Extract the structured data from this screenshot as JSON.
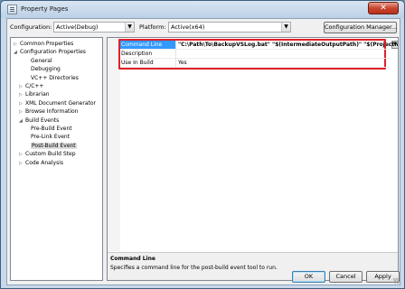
{
  "window": {
    "title": "Property Pages",
    "close_glyph": "✕"
  },
  "toolbar": {
    "configuration_label": "Configuration:",
    "configuration_value": "Active(Debug)",
    "platform_label": "Platform:",
    "platform_value": "Active(x64)",
    "config_manager_label": "Configuration Manager..."
  },
  "tree": [
    {
      "label": "Common Properties",
      "expander": "▷",
      "selected": false
    },
    {
      "label": "Configuration Properties",
      "expander": "◢",
      "selected": false
    },
    {
      "label": "General",
      "expander": "",
      "selected": false
    },
    {
      "label": "Debugging",
      "expander": "",
      "selected": false
    },
    {
      "label": "VC++ Directories",
      "expander": "",
      "selected": false
    },
    {
      "label": "C/C++",
      "expander": "▷",
      "selected": false
    },
    {
      "label": "Librarian",
      "expander": "▷",
      "selected": false
    },
    {
      "label": "XML Document Generator",
      "expander": "▷",
      "selected": false
    },
    {
      "label": "Browse Information",
      "expander": "▷",
      "selected": false
    },
    {
      "label": "Build Events",
      "expander": "◢",
      "selected": false
    },
    {
      "label": "Pre-Build Event",
      "expander": "",
      "selected": false
    },
    {
      "label": "Pre-Link Event",
      "expander": "",
      "selected": false
    },
    {
      "label": "Post-Build Event",
      "expander": "",
      "selected": true
    },
    {
      "label": "Custom Build Step",
      "expander": "▷",
      "selected": false
    },
    {
      "label": "Code Analysis",
      "expander": "▷",
      "selected": false
    }
  ],
  "properties": [
    {
      "name": "Command Line",
      "value": "\"C:\\Path\\To\\BackupVSLog.bat\" \"$(IntermediateOutputPath)\" \"$(ProjectName)\"",
      "selected": true
    },
    {
      "name": "Description",
      "value": "",
      "selected": false
    },
    {
      "name": "Use In Build",
      "value": "Yes",
      "selected": false
    }
  ],
  "dropdown_glyph": "▼",
  "description": {
    "title": "Command Line",
    "text": "Specifies a command line for the post-build event tool to run."
  },
  "buttons": {
    "ok": "OK",
    "cancel": "Cancel",
    "apply": "Apply"
  },
  "colors": {
    "selection": "#3399ff",
    "highlight_box": "#e0202a"
  }
}
